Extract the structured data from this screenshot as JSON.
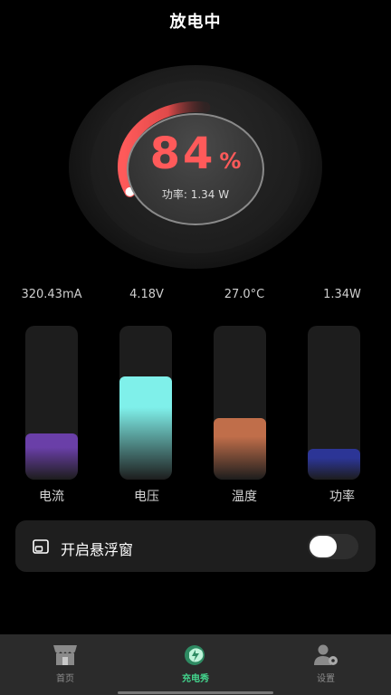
{
  "header": {
    "title": "放电中"
  },
  "gauge": {
    "percent": "84",
    "percent_sign": "%",
    "level": 0.84,
    "power_text": "功率: 1.34 W"
  },
  "stats": [
    {
      "value": "320.43mA",
      "label": "电流",
      "level": 0.3,
      "color": "#6a3fa8"
    },
    {
      "value": "4.18V",
      "label": "电压",
      "level": 0.67,
      "color": "#7ff0ea"
    },
    {
      "value": "27.0°C",
      "label": "温度",
      "level": 0.4,
      "color": "#c06e4a"
    },
    {
      "value": "1.34W",
      "label": "功率",
      "level": 0.2,
      "color": "#2c3596"
    }
  ],
  "float_window": {
    "label": "开启悬浮窗",
    "enabled": false
  },
  "tabs": [
    {
      "label": "首页",
      "icon": "store-icon",
      "active": false
    },
    {
      "label": "充电秀",
      "icon": "charge-show-icon",
      "active": true
    },
    {
      "label": "设置",
      "icon": "user-settings-icon",
      "active": false
    }
  ],
  "colors": {
    "accent_red": "#ff5a5a",
    "active_tab": "#43d68e"
  }
}
